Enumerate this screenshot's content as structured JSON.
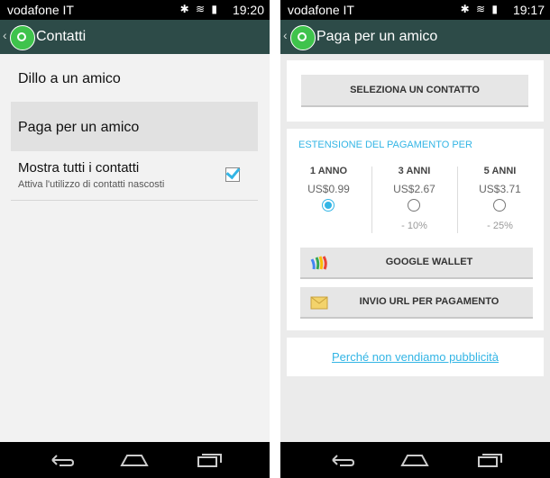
{
  "left_screen": {
    "status": {
      "carrier": "vodafone IT",
      "time": "19:20"
    },
    "title": "Contatti",
    "items": [
      {
        "label": "Dillo a un amico"
      },
      {
        "label": "Paga per un amico"
      },
      {
        "label": "Mostra tutti i contatti",
        "sublabel": "Attiva l'utilizzo di contatti nascosti",
        "checked": true
      }
    ]
  },
  "right_screen": {
    "status": {
      "carrier": "vodafone IT",
      "time": "19:17"
    },
    "title": "Paga per un amico",
    "select_contact_label": "SELEZIONA UN CONTATTO",
    "section_heading": "ESTENSIONE DEL PAGAMENTO PER",
    "plans": [
      {
        "name": "1 ANNO",
        "price": "US$0.99",
        "discount": "",
        "selected": true
      },
      {
        "name": "3 ANNI",
        "price": "US$2.67",
        "discount": "- 10%",
        "selected": false
      },
      {
        "name": "5 ANNI",
        "price": "US$3.71",
        "discount": "- 25%",
        "selected": false
      }
    ],
    "wallet_label": "GOOGLE WALLET",
    "url_label": "INVIO URL PER PAGAMENTO",
    "footer_link": "Perché non vendiamo pubblicità"
  },
  "colors": {
    "actionbar": "#2d4b48",
    "accent": "#33b5e5",
    "whatsapp_green": "#3fc34c"
  }
}
